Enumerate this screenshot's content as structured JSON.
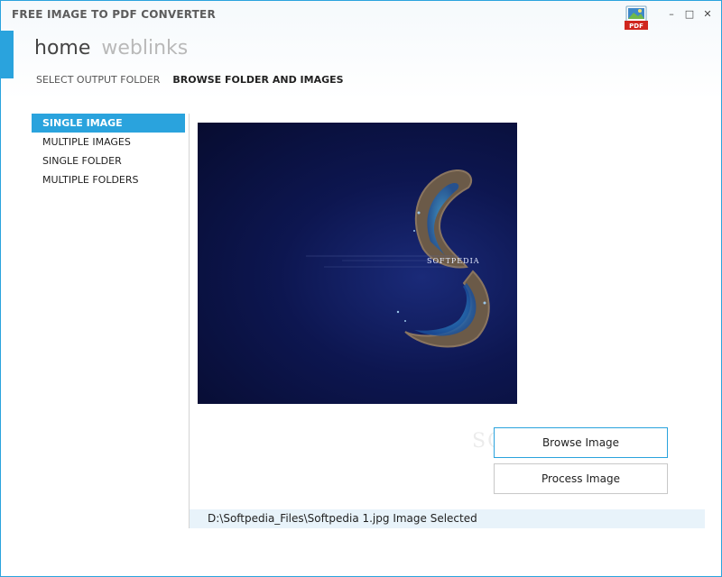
{
  "window": {
    "title": "FREE IMAGE TO PDF CONVERTER",
    "controls": {
      "minimize": "–",
      "maximize": "□",
      "close": "✕"
    },
    "icon_badge": "PDF"
  },
  "nav": {
    "tabs": [
      {
        "label": "home",
        "active": true
      },
      {
        "label": "weblinks",
        "active": false
      }
    ]
  },
  "subnav": {
    "tabs": [
      {
        "label": "SELECT OUTPUT FOLDER",
        "active": false
      },
      {
        "label": "BROWSE FOLDER AND IMAGES",
        "active": true
      }
    ]
  },
  "menu": {
    "items": [
      {
        "label": "SINGLE IMAGE",
        "active": true
      },
      {
        "label": "MULTIPLE IMAGES",
        "active": false
      },
      {
        "label": "SINGLE FOLDER",
        "active": false
      },
      {
        "label": "MULTIPLE FOLDERS",
        "active": false
      }
    ]
  },
  "preview": {
    "caption": "SOFTPEDIA"
  },
  "actions": {
    "browse_label": "Browse Image",
    "process_label": "Process Image"
  },
  "status": {
    "text": "D:\\Softpedia_Files\\Softpedia 1.jpg Image Selected"
  },
  "watermark": "SOFTPEDIA",
  "colors": {
    "accent": "#2aa3dd",
    "status_bg": "#e8f3fa"
  }
}
